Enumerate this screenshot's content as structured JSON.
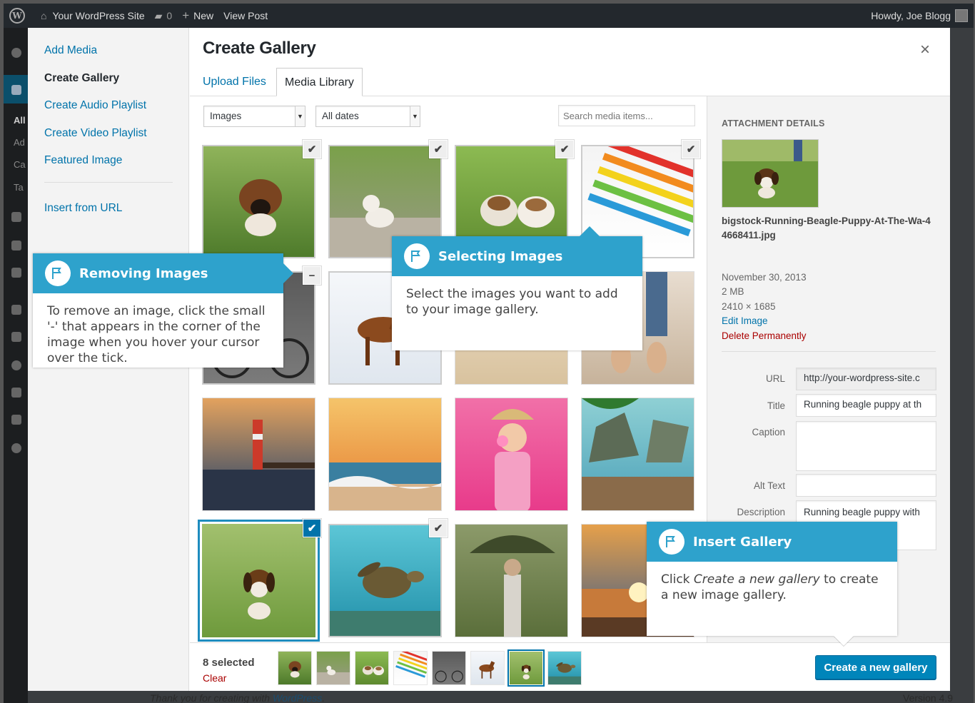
{
  "adminbar": {
    "site_name": "Your WordPress Site",
    "comments_count": "0",
    "new_label": "New",
    "view_post": "View Post",
    "howdy": "Howdy, Joe Blogg"
  },
  "admin_bg": {
    "sidebar_letters": [
      "All",
      "Ad",
      "Ca",
      "Ta"
    ],
    "footer_prefix": "Thank you for creating with ",
    "footer_link": "WordPress",
    "footer_suffix": ".",
    "version": "Version 4.9"
  },
  "menu": {
    "items": [
      "Add Media",
      "Create Gallery",
      "Create Audio Playlist",
      "Create Video Playlist",
      "Featured Image",
      "Insert from URL"
    ],
    "active": "Create Gallery"
  },
  "frame": {
    "title": "Create Gallery",
    "close": "×",
    "tabs": [
      "Upload Files",
      "Media Library"
    ],
    "active_tab": "Media Library"
  },
  "filters": {
    "type": "Images",
    "date": "All dates",
    "search_placeholder": "Search media items..."
  },
  "grid": {
    "items": [
      {
        "subject": "boxer-puppy",
        "selected": true
      },
      {
        "subject": "kitten-walking",
        "selected": true
      },
      {
        "subject": "bulldog-puppies",
        "selected": true
      },
      {
        "subject": "colored-pencils",
        "selected": true
      },
      {
        "subject": "bicycle",
        "selected": true
      },
      {
        "subject": "horse-in-snow",
        "selected": true
      },
      {
        "subject": "woman-portrait",
        "selected": false
      },
      {
        "subject": "feet-on-beach",
        "selected": false
      },
      {
        "subject": "lighthouse-pier",
        "selected": false
      },
      {
        "subject": "sunset-waves",
        "selected": false
      },
      {
        "subject": "bubblegum-girl",
        "selected": false
      },
      {
        "subject": "tropical-bay",
        "selected": false
      },
      {
        "subject": "beagle-puppy",
        "selected": true
      },
      {
        "subject": "sea-turtle",
        "selected": true
      },
      {
        "subject": "woman-umbrella",
        "selected": false
      },
      {
        "subject": "sunset-sea",
        "selected": false
      }
    ],
    "check_glyph": "✔",
    "remove_glyph": "−"
  },
  "details": {
    "heading": "Attachment Details",
    "filename": "bigstock-Running-Beagle-Puppy-At-The-Wa-44668411.jpg",
    "date": "November 30, 2013",
    "size": "2 MB",
    "dimensions": "2410 × 1685",
    "edit_link": "Edit Image",
    "delete_link": "Delete Permanently",
    "fields": {
      "url_label": "URL",
      "url_value": "http://your-wordpress-site.c",
      "title_label": "Title",
      "title_value": "Running beagle puppy at th",
      "caption_label": "Caption",
      "caption_value": "",
      "alt_label": "Alt Text",
      "alt_value": "",
      "description_label": "Description",
      "description_value": "Running beagle puppy with flying ears at the walk"
    }
  },
  "bottom": {
    "selected_count": "8 selected",
    "clear": "Clear",
    "button": "Create a new gallery"
  },
  "callouts": {
    "removing": {
      "title": "Removing Images",
      "body": "To remove an image, click the small '-' that appears in the corner of the image when you hover your cursor over the tick."
    },
    "selecting": {
      "title": "Selecting Images",
      "body": "Select the images you want to add to your image gallery."
    },
    "insert": {
      "title": "Insert Gallery",
      "body_pre": "Click ",
      "body_em": "Create a new gallery",
      "body_post": " to create a new image gallery."
    }
  },
  "colors": {
    "accent": "#0073aa",
    "callout_header": "#2ea2cc",
    "delete_red": "#a00",
    "button_blue": "#0085ba"
  }
}
